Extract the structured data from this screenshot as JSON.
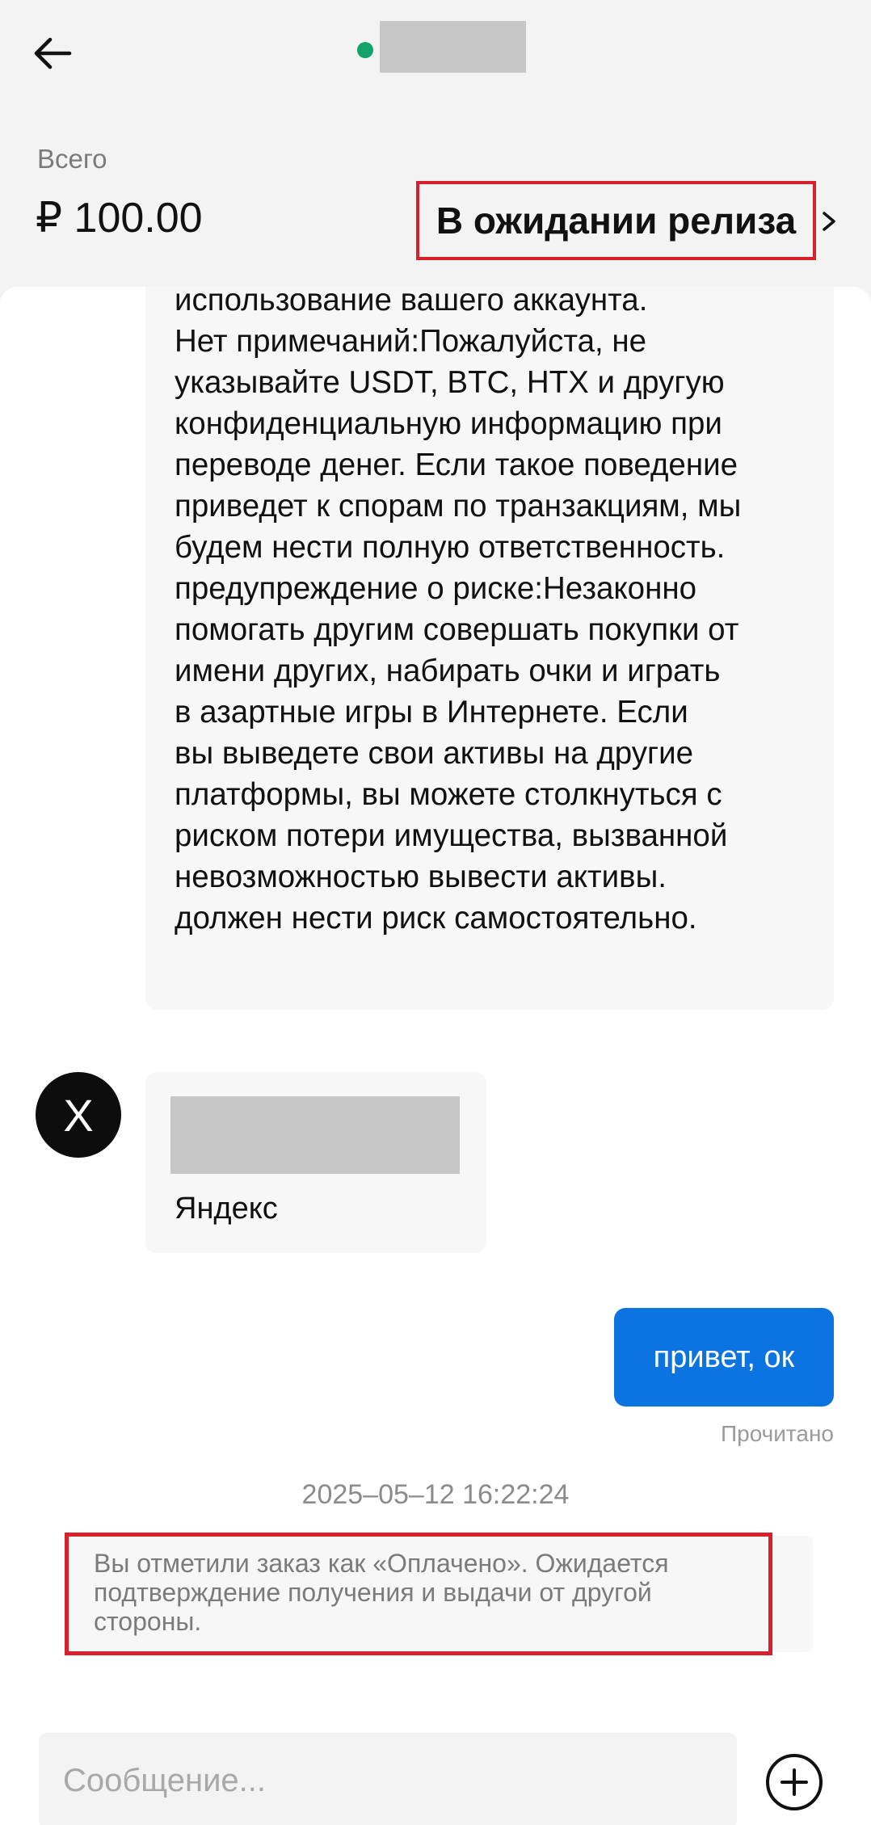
{
  "header": {
    "counterparty_name": "",
    "online_color": "#13a36b",
    "back_icon": "arrow-left-icon"
  },
  "summary": {
    "total_label": "Всего",
    "total_amount": "₽ 100.00",
    "status": "В ожидании релиза",
    "status_chevron_icon": "chevron-right-icon"
  },
  "messages": {
    "terms_text": "отказать в сделке и прямо повлиять на\nиспользование вашего аккаунта.\nНет примечаний:Пожалуйста, не\nуказывайте USDT, BTC, HTX и другую\nконфиденциальную информацию при\nпереводе денег. Если такое поведение\nприведет к спорам по транзакциям, мы\nбудем нести полную ответственность.\nпредупреждение о риске:Незаконно\nпомогать другим совершать покупки от\nимени других, набирать очки и играть\nв азартные игры в Интернете. Если\nвы выведете свои активы на другие\nплатформы, вы можете столкнуться с\nриском потери имущества, вызванной\nневозможностью вывести активы.\nдолжен нести риск самостоятельно.",
    "avatar_letter": "X",
    "payment_method": "Яндекс",
    "my_message": "привет, ок",
    "read_status": "Прочитано",
    "timestamp": "2025–05–12 16:22:24",
    "system_note": "Вы отметили заказ как «Оплачено». Ожидается подтверждение получения и выдачи от другой стороны."
  },
  "composer": {
    "placeholder": "Сообщение...",
    "add_icon": "plus-circle-icon"
  },
  "colors": {
    "accent_blue": "#0b74e0",
    "highlight_red": "#d8202a",
    "avatar_bg": "#0d0d0d"
  }
}
